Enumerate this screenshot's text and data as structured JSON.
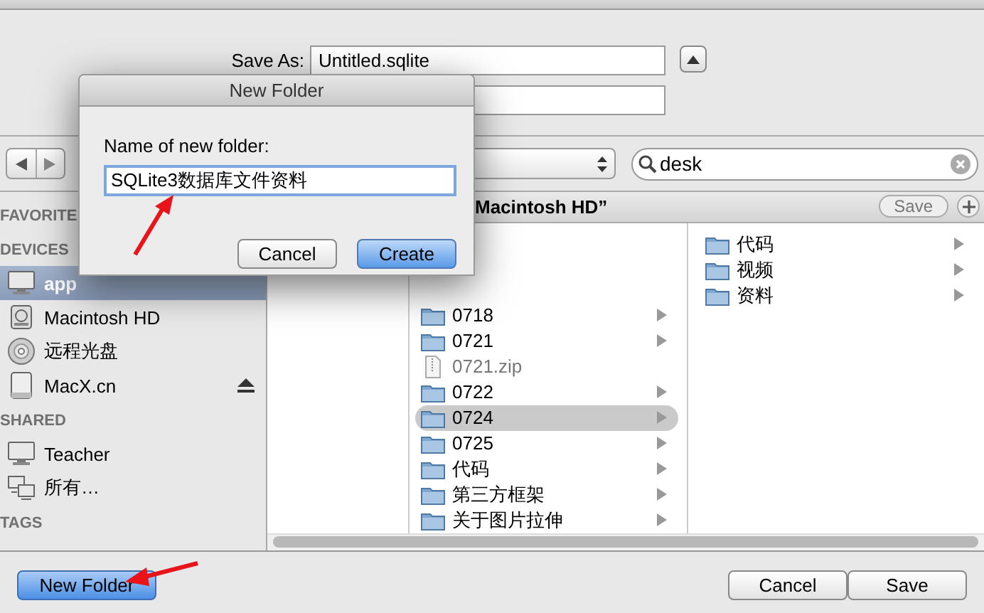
{
  "save_as": {
    "label": "Save As:",
    "value": "Untitled.sqlite"
  },
  "search": {
    "value": "desk"
  },
  "header": {
    "title": "Macintosh HD”",
    "save_button": "Save"
  },
  "sidebar": [
    {
      "heading": "FAVORITE"
    },
    {
      "heading": "DEVICES",
      "items": [
        {
          "label": "app",
          "kind": "computer",
          "selected": true,
          "eject": false
        },
        {
          "label": "Macintosh HD",
          "kind": "harddisk",
          "selected": false,
          "eject": false
        },
        {
          "label": "远程光盘",
          "kind": "disc",
          "selected": false,
          "eject": false
        },
        {
          "label": "MacX.cn",
          "kind": "volume",
          "selected": false,
          "eject": true
        }
      ]
    },
    {
      "heading": "SHARED",
      "items": [
        {
          "label": "Teacher",
          "kind": "computer",
          "selected": false,
          "eject": false
        },
        {
          "label": "所有…",
          "kind": "network",
          "selected": false,
          "eject": false
        }
      ]
    },
    {
      "heading": "TAGS"
    }
  ],
  "columns": [
    {
      "items": [
        {
          "label": "0718",
          "kind": "folder",
          "selected": false
        },
        {
          "label": "0721",
          "kind": "folder",
          "selected": false
        },
        {
          "label": "0721.zip",
          "kind": "zip",
          "selected": false
        },
        {
          "label": "0722",
          "kind": "folder",
          "selected": false
        },
        {
          "label": "0724",
          "kind": "folder",
          "selected": true
        },
        {
          "label": "0725",
          "kind": "folder",
          "selected": false
        },
        {
          "label": "代码",
          "kind": "folder",
          "selected": false
        },
        {
          "label": "第三方框架",
          "kind": "folder",
          "selected": false
        },
        {
          "label": "关于图片拉伸",
          "kind": "folder",
          "selected": false
        }
      ]
    },
    {
      "items": [
        {
          "label": "代码",
          "kind": "folder",
          "selected": false
        },
        {
          "label": "视频",
          "kind": "folder",
          "selected": false
        },
        {
          "label": "资料",
          "kind": "folder",
          "selected": false
        }
      ]
    }
  ],
  "dialog": {
    "title": "New Folder",
    "prompt": "Name of new folder:",
    "value": "SQLite3数据库文件资料",
    "buttons": [
      {
        "label": "Cancel",
        "default": false
      },
      {
        "label": "Create",
        "default": true
      }
    ]
  },
  "footer": {
    "new_folder": "New Folder",
    "buttons": [
      {
        "label": "Cancel",
        "default": false
      },
      {
        "label": "Save",
        "default": false
      }
    ]
  }
}
